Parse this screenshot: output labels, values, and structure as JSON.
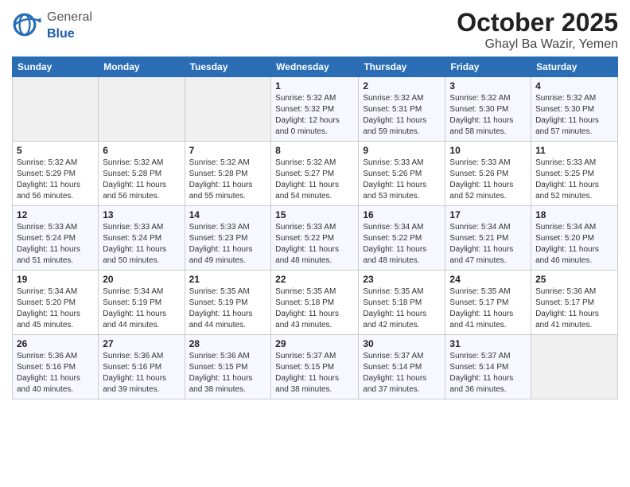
{
  "header": {
    "logo_general": "General",
    "logo_blue": "Blue",
    "month": "October 2025",
    "location": "Ghayl Ba Wazir, Yemen"
  },
  "days_of_week": [
    "Sunday",
    "Monday",
    "Tuesday",
    "Wednesday",
    "Thursday",
    "Friday",
    "Saturday"
  ],
  "weeks": [
    [
      {
        "num": "",
        "info": ""
      },
      {
        "num": "",
        "info": ""
      },
      {
        "num": "",
        "info": ""
      },
      {
        "num": "1",
        "info": "Sunrise: 5:32 AM\nSunset: 5:32 PM\nDaylight: 12 hours\nand 0 minutes."
      },
      {
        "num": "2",
        "info": "Sunrise: 5:32 AM\nSunset: 5:31 PM\nDaylight: 11 hours\nand 59 minutes."
      },
      {
        "num": "3",
        "info": "Sunrise: 5:32 AM\nSunset: 5:30 PM\nDaylight: 11 hours\nand 58 minutes."
      },
      {
        "num": "4",
        "info": "Sunrise: 5:32 AM\nSunset: 5:30 PM\nDaylight: 11 hours\nand 57 minutes."
      }
    ],
    [
      {
        "num": "5",
        "info": "Sunrise: 5:32 AM\nSunset: 5:29 PM\nDaylight: 11 hours\nand 56 minutes."
      },
      {
        "num": "6",
        "info": "Sunrise: 5:32 AM\nSunset: 5:28 PM\nDaylight: 11 hours\nand 56 minutes."
      },
      {
        "num": "7",
        "info": "Sunrise: 5:32 AM\nSunset: 5:28 PM\nDaylight: 11 hours\nand 55 minutes."
      },
      {
        "num": "8",
        "info": "Sunrise: 5:32 AM\nSunset: 5:27 PM\nDaylight: 11 hours\nand 54 minutes."
      },
      {
        "num": "9",
        "info": "Sunrise: 5:33 AM\nSunset: 5:26 PM\nDaylight: 11 hours\nand 53 minutes."
      },
      {
        "num": "10",
        "info": "Sunrise: 5:33 AM\nSunset: 5:26 PM\nDaylight: 11 hours\nand 52 minutes."
      },
      {
        "num": "11",
        "info": "Sunrise: 5:33 AM\nSunset: 5:25 PM\nDaylight: 11 hours\nand 52 minutes."
      }
    ],
    [
      {
        "num": "12",
        "info": "Sunrise: 5:33 AM\nSunset: 5:24 PM\nDaylight: 11 hours\nand 51 minutes."
      },
      {
        "num": "13",
        "info": "Sunrise: 5:33 AM\nSunset: 5:24 PM\nDaylight: 11 hours\nand 50 minutes."
      },
      {
        "num": "14",
        "info": "Sunrise: 5:33 AM\nSunset: 5:23 PM\nDaylight: 11 hours\nand 49 minutes."
      },
      {
        "num": "15",
        "info": "Sunrise: 5:33 AM\nSunset: 5:22 PM\nDaylight: 11 hours\nand 48 minutes."
      },
      {
        "num": "16",
        "info": "Sunrise: 5:34 AM\nSunset: 5:22 PM\nDaylight: 11 hours\nand 48 minutes."
      },
      {
        "num": "17",
        "info": "Sunrise: 5:34 AM\nSunset: 5:21 PM\nDaylight: 11 hours\nand 47 minutes."
      },
      {
        "num": "18",
        "info": "Sunrise: 5:34 AM\nSunset: 5:20 PM\nDaylight: 11 hours\nand 46 minutes."
      }
    ],
    [
      {
        "num": "19",
        "info": "Sunrise: 5:34 AM\nSunset: 5:20 PM\nDaylight: 11 hours\nand 45 minutes."
      },
      {
        "num": "20",
        "info": "Sunrise: 5:34 AM\nSunset: 5:19 PM\nDaylight: 11 hours\nand 44 minutes."
      },
      {
        "num": "21",
        "info": "Sunrise: 5:35 AM\nSunset: 5:19 PM\nDaylight: 11 hours\nand 44 minutes."
      },
      {
        "num": "22",
        "info": "Sunrise: 5:35 AM\nSunset: 5:18 PM\nDaylight: 11 hours\nand 43 minutes."
      },
      {
        "num": "23",
        "info": "Sunrise: 5:35 AM\nSunset: 5:18 PM\nDaylight: 11 hours\nand 42 minutes."
      },
      {
        "num": "24",
        "info": "Sunrise: 5:35 AM\nSunset: 5:17 PM\nDaylight: 11 hours\nand 41 minutes."
      },
      {
        "num": "25",
        "info": "Sunrise: 5:36 AM\nSunset: 5:17 PM\nDaylight: 11 hours\nand 41 minutes."
      }
    ],
    [
      {
        "num": "26",
        "info": "Sunrise: 5:36 AM\nSunset: 5:16 PM\nDaylight: 11 hours\nand 40 minutes."
      },
      {
        "num": "27",
        "info": "Sunrise: 5:36 AM\nSunset: 5:16 PM\nDaylight: 11 hours\nand 39 minutes."
      },
      {
        "num": "28",
        "info": "Sunrise: 5:36 AM\nSunset: 5:15 PM\nDaylight: 11 hours\nand 38 minutes."
      },
      {
        "num": "29",
        "info": "Sunrise: 5:37 AM\nSunset: 5:15 PM\nDaylight: 11 hours\nand 38 minutes."
      },
      {
        "num": "30",
        "info": "Sunrise: 5:37 AM\nSunset: 5:14 PM\nDaylight: 11 hours\nand 37 minutes."
      },
      {
        "num": "31",
        "info": "Sunrise: 5:37 AM\nSunset: 5:14 PM\nDaylight: 11 hours\nand 36 minutes."
      },
      {
        "num": "",
        "info": ""
      }
    ]
  ]
}
